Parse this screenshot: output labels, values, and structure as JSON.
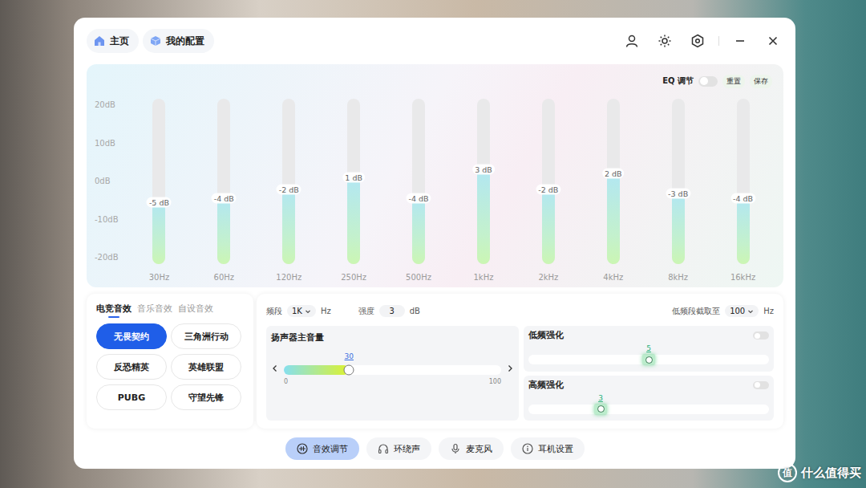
{
  "header": {
    "tabs": [
      {
        "label": "主页",
        "selected": false
      },
      {
        "label": "我的配置",
        "selected": false
      }
    ]
  },
  "eq": {
    "title": "EQ 调节",
    "enabled": false,
    "reset": "重置",
    "save": "保存",
    "axis": [
      "20dB",
      "10dB",
      "0dB",
      "-10dB",
      "-20dB"
    ],
    "min": -20,
    "max": 20,
    "bands": [
      {
        "freq": "30Hz",
        "value": -5,
        "reading": "-5 dB"
      },
      {
        "freq": "60Hz",
        "value": -4,
        "reading": "-4 dB"
      },
      {
        "freq": "120Hz",
        "value": -2,
        "reading": "-2 dB"
      },
      {
        "freq": "250Hz",
        "value": 1,
        "reading": "1 dB"
      },
      {
        "freq": "500Hz",
        "value": -4,
        "reading": "-4 dB"
      },
      {
        "freq": "1kHz",
        "value": 3,
        "reading": "3 dB"
      },
      {
        "freq": "2kHz",
        "value": -2,
        "reading": "-2 dB"
      },
      {
        "freq": "4kHz",
        "value": 2,
        "reading": "2 dB"
      },
      {
        "freq": "8kHz",
        "value": -3,
        "reading": "-3 dB"
      },
      {
        "freq": "16kHz",
        "value": -4,
        "reading": "-4 dB"
      }
    ]
  },
  "presets": {
    "tabs": [
      {
        "label": "电竞音效",
        "selected": true
      },
      {
        "label": "音乐音效",
        "selected": false
      },
      {
        "label": "自设音效",
        "selected": false
      }
    ],
    "items": [
      {
        "label": "无畏契约",
        "selected": true
      },
      {
        "label": "三角洲行动",
        "selected": false
      },
      {
        "label": "反恐精英",
        "selected": false
      },
      {
        "label": "英雄联盟",
        "selected": false
      },
      {
        "label": "PUBG",
        "selected": false
      },
      {
        "label": "守望先锋",
        "selected": false
      }
    ]
  },
  "controls": {
    "band": {
      "label": "频段",
      "value": "1K",
      "unit": "Hz"
    },
    "strength": {
      "label": "强度",
      "value": "3",
      "unit": "dB"
    },
    "lowcut": {
      "label": "低频段截取至",
      "value": "100",
      "unit": "Hz"
    },
    "volume": {
      "title": "扬声器主音量",
      "level": 0.3,
      "reading": "30",
      "min": "0",
      "max": "100"
    },
    "enhancers": [
      {
        "title": "低频强化",
        "on": false,
        "level": 0.5,
        "reading": "5"
      },
      {
        "title": "高频强化",
        "on": false,
        "level": 0.3,
        "reading": "3"
      }
    ]
  },
  "nav": [
    {
      "label": "音效调节",
      "selected": true
    },
    {
      "label": "环绕声",
      "selected": false
    },
    {
      "label": "麦克风",
      "selected": false
    },
    {
      "label": "耳机设置",
      "selected": false
    }
  ],
  "watermark": {
    "logo": "值",
    "text": "什么值得买"
  }
}
